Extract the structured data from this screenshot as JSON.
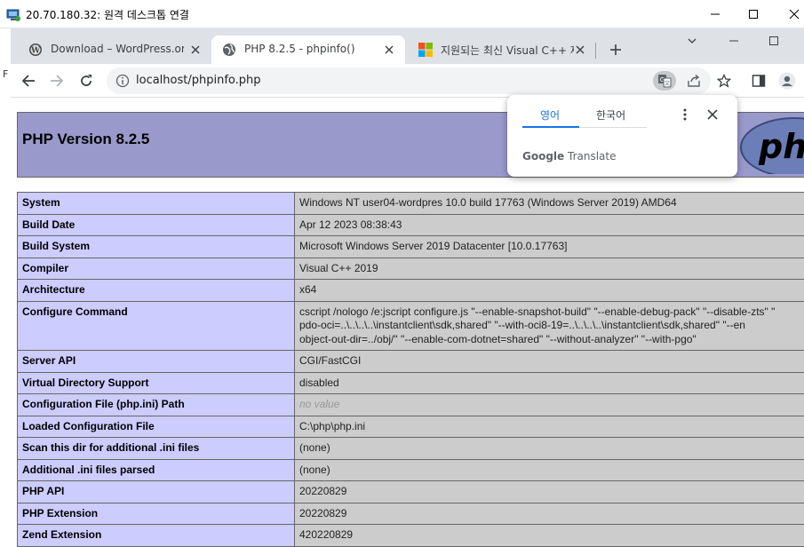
{
  "rdp": {
    "title": "20.70.180.32: 원격 데스크톱 연결",
    "side_letter": "F"
  },
  "tabs": [
    {
      "label": "Download – WordPress.org",
      "icon": "wordpress-icon"
    },
    {
      "label": "PHP 8.2.5 - phpinfo()",
      "icon": "globe-icon"
    },
    {
      "label": "지원되는 최신 Visual C++ 재",
      "icon": "microsoft-icon"
    }
  ],
  "toolbar": {
    "url": "localhost/phpinfo.php"
  },
  "translate": {
    "source_lang": "영어",
    "target_lang": "한국어",
    "brand_google": "Google",
    "brand_translate": "Translate"
  },
  "php": {
    "header_title": "PHP Version 8.2.5",
    "logo_text": "php",
    "rows": [
      {
        "key": "System",
        "value": "Windows NT user04-wordpres 10.0 build 17763 (Windows Server 2019) AMD64"
      },
      {
        "key": "Build Date",
        "value": "Apr 12 2023 08:38:43"
      },
      {
        "key": "Build System",
        "value": "Microsoft Windows Server 2019 Datacenter [10.0.17763]"
      },
      {
        "key": "Compiler",
        "value": "Visual C++ 2019"
      },
      {
        "key": "Architecture",
        "value": "x64"
      },
      {
        "key": "Configure Command",
        "value_lines": [
          "cscript /nologo /e:jscript configure.js \"--enable-snapshot-build\" \"--enable-debug-pack\" \"--disable-zts\" \"",
          "pdo-oci=..\\..\\..\\..\\instantclient\\sdk,shared\" \"--with-oci8-19=..\\..\\..\\..\\instantclient\\sdk,shared\" \"--en",
          "object-out-dir=../obj/\" \"--enable-com-dotnet=shared\" \"--without-analyzer\" \"--with-pgo\""
        ]
      },
      {
        "key": "Server API",
        "value": "CGI/FastCGI"
      },
      {
        "key": "Virtual Directory Support",
        "value": "disabled"
      },
      {
        "key": "Configuration File (php.ini) Path",
        "value": "no value",
        "novalue": true
      },
      {
        "key": "Loaded Configuration File",
        "value": "C:\\php\\php.ini"
      },
      {
        "key": "Scan this dir for additional .ini files",
        "value": "(none)"
      },
      {
        "key": "Additional .ini files parsed",
        "value": "(none)"
      },
      {
        "key": "PHP API",
        "value": "20220829"
      },
      {
        "key": "PHP Extension",
        "value": "20220829"
      },
      {
        "key": "Zend Extension",
        "value": "420220829"
      }
    ]
  },
  "colors": {
    "php_header": "#9999cc",
    "php_key": "#ccccff",
    "php_value": "#cccccc",
    "chrome_accent": "#1a73e8",
    "tabstrip": "#dee1e6"
  }
}
